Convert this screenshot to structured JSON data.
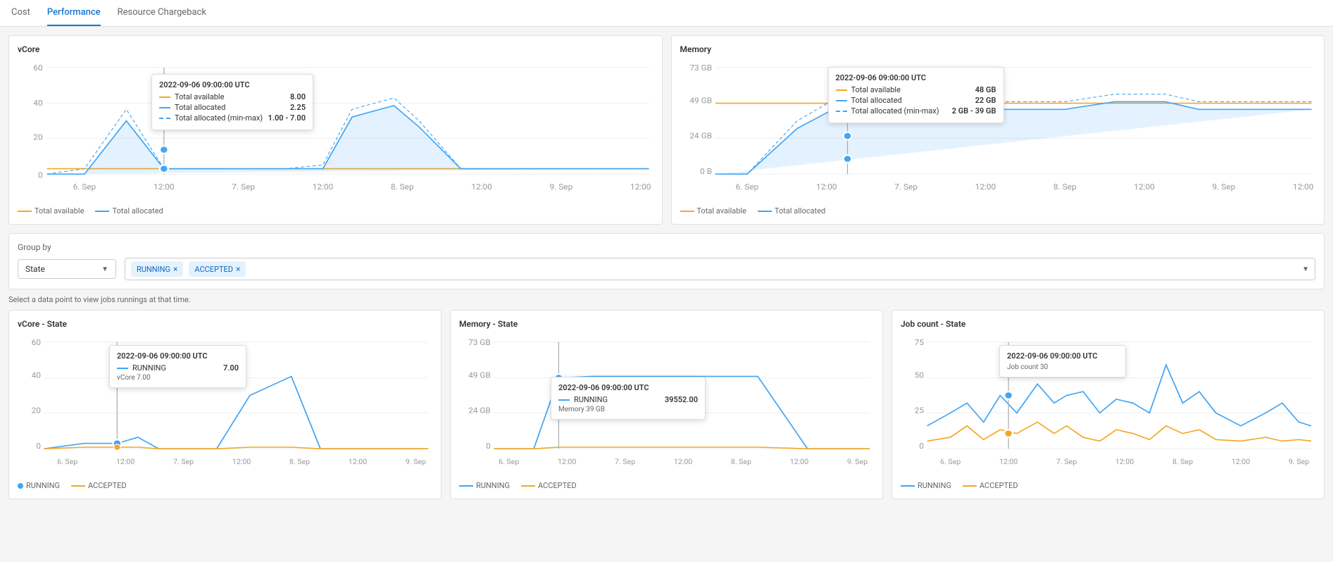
{
  "nav": {
    "tabs": [
      {
        "label": "Cost",
        "active": false
      },
      {
        "label": "Performance",
        "active": true
      },
      {
        "label": "Resource Chargeback",
        "active": false
      }
    ]
  },
  "vcore_chart": {
    "title": "vCore",
    "y_labels": [
      "60",
      "40",
      "20",
      "0"
    ],
    "x_labels": [
      "6. Sep",
      "12:00",
      "7. Sep",
      "12:00",
      "8. Sep",
      "12:00",
      "9. Sep",
      "12:00"
    ],
    "tooltip": {
      "time": "2022-09-06 09:00:00 UTC",
      "rows": [
        {
          "color": "#f5a623",
          "style": "solid",
          "label": "Total available",
          "value": "8.00"
        },
        {
          "color": "#42a5f5",
          "style": "solid",
          "label": "Total allocated",
          "value": "2.25"
        },
        {
          "color": "#42a5f5",
          "style": "dashed",
          "label": "Total allocated (min-max)",
          "value": "1.00 - 7.00"
        }
      ]
    },
    "legend": [
      {
        "label": "Total available",
        "color": "#f5a623",
        "style": "solid"
      },
      {
        "label": "Total allocated",
        "color": "#42a5f5",
        "style": "solid"
      }
    ]
  },
  "memory_chart": {
    "title": "Memory",
    "y_labels": [
      "73 GB",
      "49 GB",
      "24 GB",
      "0 B"
    ],
    "x_labels": [
      "6. Sep",
      "12:00",
      "7. Sep",
      "12:00",
      "8. Sep",
      "12:00",
      "9. Sep",
      "12:00"
    ],
    "tooltip": {
      "time": "2022-09-06 09:00:00 UTC",
      "rows": [
        {
          "color": "#f5a623",
          "style": "solid",
          "label": "Total available",
          "value": "48 GB"
        },
        {
          "color": "#42a5f5",
          "style": "solid",
          "label": "Total allocated",
          "value": "22 GB"
        },
        {
          "color": "#42a5f5",
          "style": "dashed",
          "label": "Total allocated (min-max)",
          "value": "2 GB - 39 GB"
        }
      ]
    },
    "legend": [
      {
        "label": "Total available",
        "color": "#f5a623",
        "style": "solid"
      },
      {
        "label": "Total allocated",
        "color": "#42a5f5",
        "style": "solid"
      }
    ]
  },
  "group_by": {
    "label": "Group by",
    "dropdown_value": "State",
    "tags": [
      "RUNNING",
      "ACCEPTED"
    ],
    "dropdown_arrow": "▼"
  },
  "select_hint": "Select a data point to view jobs runnings at that time.",
  "vcore_state_chart": {
    "title": "vCore - State",
    "y_labels": [
      "60",
      "40",
      "20",
      "0"
    ],
    "x_labels": [
      "6. Sep",
      "12:00",
      "7. Sep",
      "12:00",
      "8. Sep",
      "12:00",
      "9. Sep",
      "12:00"
    ],
    "tooltip": {
      "time": "2022-09-06 09:00:00 UTC",
      "rows": [
        {
          "color": "#42a5f5",
          "style": "solid",
          "label": "RUNNING",
          "value": "7.00"
        }
      ],
      "sub": "vCore 7.00"
    },
    "legend": [
      {
        "label": "RUNNING",
        "color": "#42a5f5",
        "dot": true
      },
      {
        "label": "ACCEPTED",
        "color": "#f5a623",
        "dot": false
      }
    ]
  },
  "memory_state_chart": {
    "title": "Memory - State",
    "y_labels": [
      "73 GB",
      "49 GB",
      "24 GB",
      "0"
    ],
    "x_labels": [
      "6. Sep",
      "12:00",
      "7. Sep",
      "12:00",
      "8. Sep",
      "12:00",
      "9. Sep",
      "12:00"
    ],
    "tooltip": {
      "time": "2022-09-06 09:00:00 UTC",
      "rows": [
        {
          "color": "#42a5f5",
          "style": "solid",
          "label": "RUNNING",
          "value": "39552.00"
        }
      ],
      "sub": "Memory 39 GB"
    },
    "legend": [
      {
        "label": "RUNNING",
        "color": "#42a5f5",
        "dot": false
      },
      {
        "label": "ACCEPTED",
        "color": "#f5a623",
        "dot": false
      }
    ]
  },
  "jobcount_state_chart": {
    "title": "Job count - State",
    "y_labels": [
      "75",
      "50",
      "25",
      "0"
    ],
    "x_labels": [
      "6. Sep",
      "12:00",
      "7. Sep",
      "12:00",
      "8. Sep",
      "12:00",
      "9. Sep",
      "12:00"
    ],
    "tooltip": {
      "time": "2022-09-06 09:00:00 UTC",
      "sub": "Job count 30"
    },
    "legend": [
      {
        "label": "RUNNING",
        "color": "#42a5f5",
        "dot": false
      },
      {
        "label": "ACCEPTED",
        "color": "#f5a623",
        "dot": false
      }
    ]
  }
}
